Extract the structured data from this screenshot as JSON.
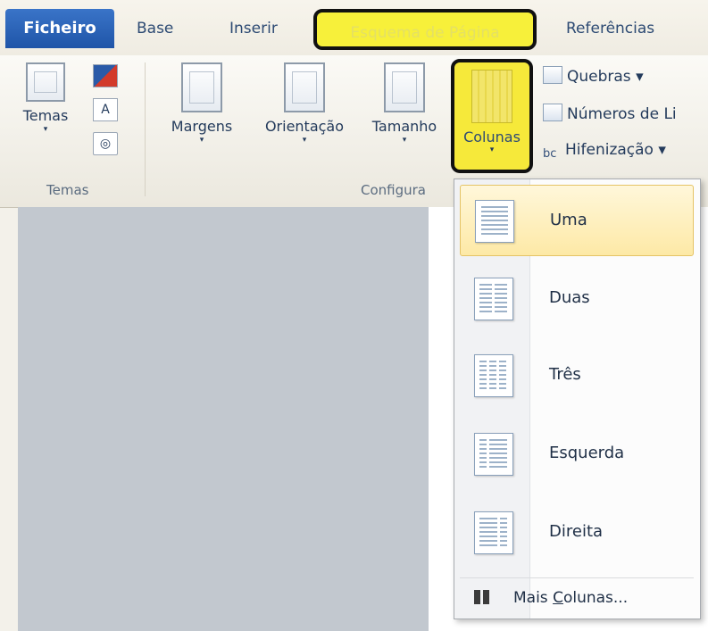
{
  "tabs": {
    "file": "Ficheiro",
    "home": "Base",
    "insert": "Inserir",
    "page_layout": "Esquema de Página",
    "references": "Referências"
  },
  "ribbon": {
    "themes_label": "Temas",
    "themes_group": "Temas",
    "margins": "Margens",
    "orientation": "Orientação",
    "size": "Tamanho",
    "columns": "Colunas",
    "breaks": "Quebras ▾",
    "line_numbers": "Números de Li",
    "hyphenation": "Hifenização ▾",
    "page_setup_group": "Configura",
    "dropdown_arrow": "▾"
  },
  "columns_menu": {
    "items": [
      {
        "label": "Uma",
        "columns": 1,
        "selected": true
      },
      {
        "label": "Duas",
        "columns": 2
      },
      {
        "label": "Três",
        "columns": 3
      },
      {
        "label": "Esquerda",
        "columns": "left"
      },
      {
        "label": "Direita",
        "columns": "right"
      }
    ],
    "more_prefix": "Mais ",
    "more_underlined": "C",
    "more_rest": "olunas..."
  },
  "colors": {
    "highlight": "#f6e93a",
    "file_tab": "#2a63b8",
    "selected_item": "#fde9a6"
  }
}
